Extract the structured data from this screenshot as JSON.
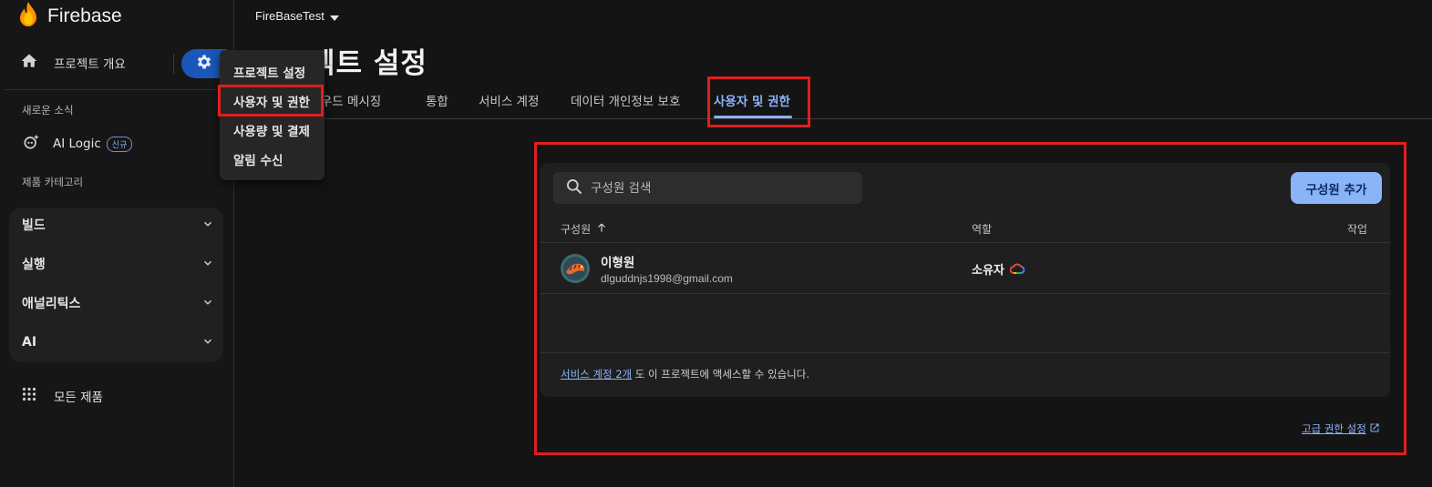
{
  "brand": {
    "name": "Firebase"
  },
  "sidebar": {
    "overview_label": "프로젝트 개요",
    "news_section": "새로운 소식",
    "ai_logic_label": "AI Logic",
    "ai_logic_badge": "신규",
    "category_section": "제품 카테고리",
    "categories": [
      {
        "label": "빌드"
      },
      {
        "label": "실행"
      },
      {
        "label": "애널리틱스"
      },
      {
        "label": "AI"
      }
    ],
    "all_products_label": "모든 제품"
  },
  "header": {
    "project_name": "FireBaseTest",
    "page_title": "프로젝트 설정"
  },
  "tabs": [
    {
      "label": "클라우드 메시징"
    },
    {
      "label": "통합"
    },
    {
      "label": "서비스 계정"
    },
    {
      "label": "데이터 개인정보 보호"
    },
    {
      "label": "사용자 및 권한",
      "active": true
    }
  ],
  "settings_menu": {
    "items": [
      {
        "label": "프로젝트 설정"
      },
      {
        "label": "사용자 및 권한",
        "highlighted": true
      },
      {
        "label": "사용량 및 결제"
      },
      {
        "label": "알림 수신"
      }
    ]
  },
  "members": {
    "search_placeholder": "구성원 검색",
    "add_button": "구성원 추가",
    "columns": {
      "member": "구성원",
      "role": "역할",
      "action": "작업"
    },
    "rows": [
      {
        "name": "이형원",
        "email": "dlguddnjs1998@gmail.com",
        "role": "소유자"
      }
    ],
    "footer_link": "서비스 계정 2개",
    "footer_text": " 도 이 프로젝트에 액세스할 수 있습니다.",
    "advanced_link": "고급 권한 설정"
  },
  "colors": {
    "accent": "#8ab4f8",
    "gear_button": "#1a57b8",
    "highlight_box": "#e01e1e",
    "background": "#141414"
  }
}
